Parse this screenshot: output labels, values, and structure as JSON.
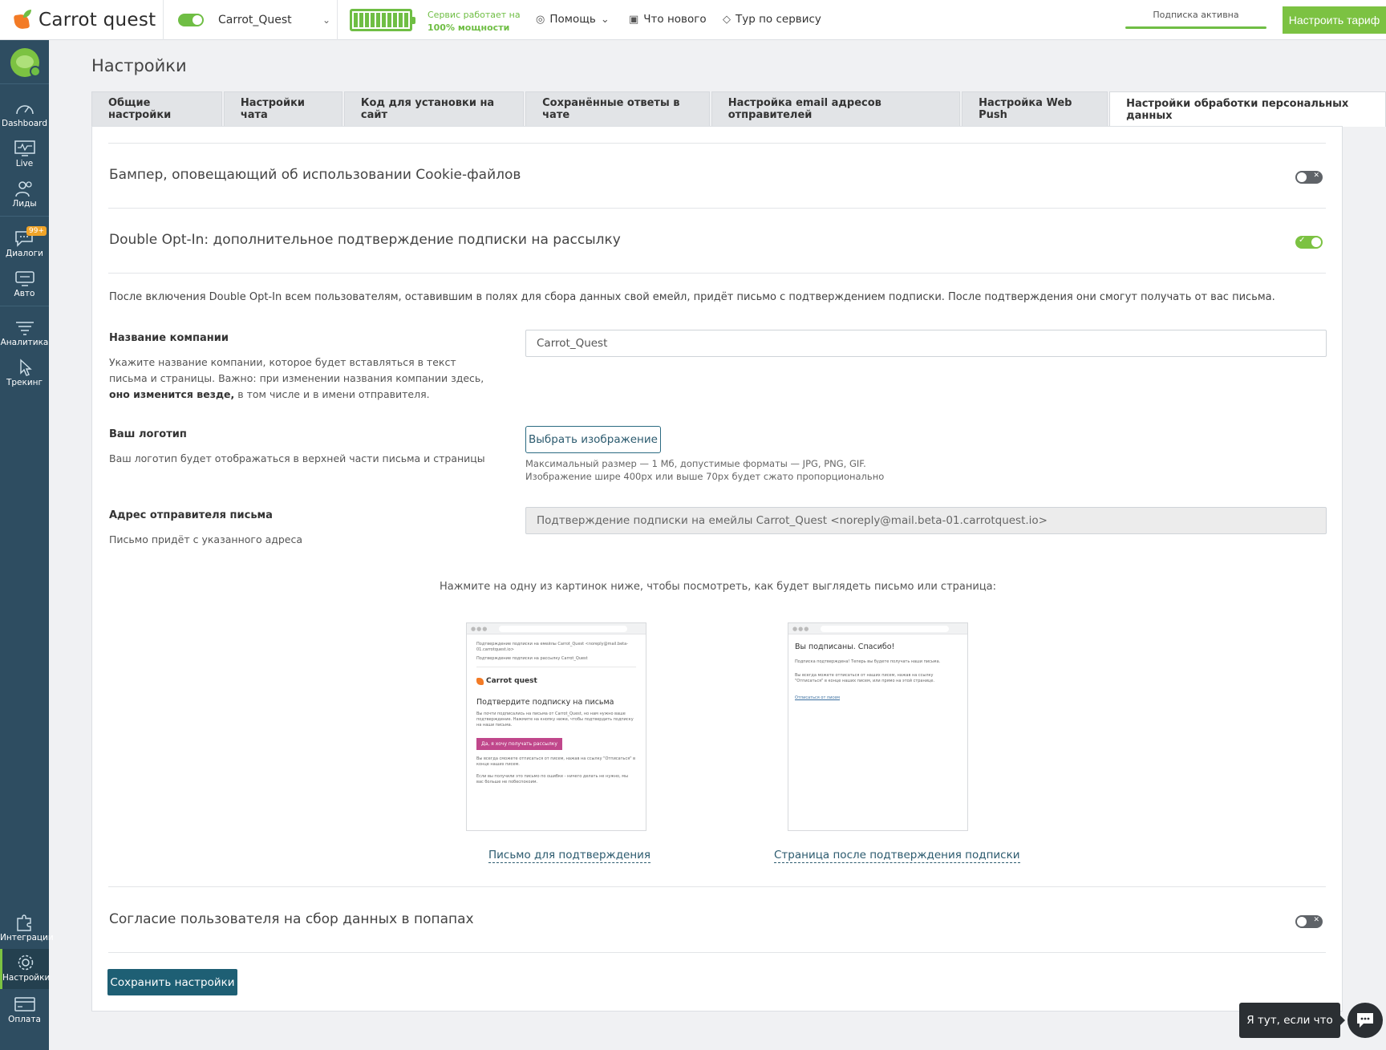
{
  "topbar": {
    "logo_text": "Carrot quest",
    "project_name": "Carrot_Quest",
    "service_status_line1": "Сервис работает на",
    "service_status_line2": "100% мощности",
    "help_label": "Помощь",
    "whats_new_label": "Что нового",
    "tour_label": "Тур по сервису",
    "subscription_label": "Подписка активна",
    "tariff_button": "Настроить тариф"
  },
  "sidebar": {
    "items": [
      {
        "label": "Dashboard"
      },
      {
        "label": "Live"
      },
      {
        "label": "Лиды"
      },
      {
        "label": "Диалоги",
        "badge": "99+"
      },
      {
        "label": "Авто"
      },
      {
        "label": "Аналитика"
      },
      {
        "label": "Трекинг"
      },
      {
        "label": "Интеграции"
      },
      {
        "label": "Настройки"
      },
      {
        "label": "Оплата"
      }
    ]
  },
  "page": {
    "title": "Настройки",
    "tabs": [
      {
        "label": "Общие настройки"
      },
      {
        "label": "Настройки чата"
      },
      {
        "label": "Код для установки на сайт"
      },
      {
        "label": "Сохранённые ответы в чате"
      },
      {
        "label": "Настройка email адресов отправителей"
      },
      {
        "label": "Настройка Web Push"
      },
      {
        "label": "Настройки обработки персональных данных"
      }
    ]
  },
  "sections": {
    "cookie": {
      "title": "Бампер, оповещающий об использовании Cookie-файлов",
      "enabled": false
    },
    "double_opt_in": {
      "title": "Double Opt-In: дополнительное подтверждение подписки на рассылку",
      "enabled": true,
      "description": "После включения Double Opt-In всем пользователям, оставившим в полях для сбора данных свой емейл, придёт письмо с подтверждением подписки. После подтверждения они смогут получать от вас письма.",
      "company_label": "Название компании",
      "company_help_1": "Укажите название компании, которое будет вставляться в текст письма и страницы. Важно: при изменении названия компании здесь,",
      "company_help_bold": "оно изменится везде,",
      "company_help_2": "в том числе и в имени отправителя.",
      "company_value": "Carrot_Quest",
      "logo_label": "Ваш логотип",
      "logo_help": "Ваш логотип будет отображаться в верхней части письма и страницы",
      "logo_button": "Выбрать изображение",
      "logo_hint_1": "Максимальный размер — 1 Мб, допустимые форматы — JPG, PNG, GIF.",
      "logo_hint_2": "Изображение шире 400px или выше 70px будет сжато пропорционально",
      "sender_label": "Адрес отправителя письма",
      "sender_help": "Письмо придёт с указанного адреса",
      "sender_value": "Подтверждение подписки на емейлы Carrot_Quest <noreply@mail.beta-01.carrotquest.io>",
      "preview_caption": "Нажмите на одну из картинок ниже, чтобы посмотреть, как будет выглядеть письмо или страница:",
      "preview_email": {
        "meta_1": "Подтверждение подписки на емейлы Carrot_Quest <noreply@mail.beta-01.carrotquest.io>",
        "meta_2": "Подтверждение подписки на рассылку Carrot_Quest",
        "brand": "Carrot quest",
        "heading": "Подтвердите подписку на письма",
        "body": "Вы почти подписались на письма от Carrot_Quest, но нам нужно ваше подтверждение. Нажмите на кнопку ниже, чтобы подтвердить подписку на наши письма.",
        "button": "Да, я хочу получать рассылку",
        "body_2": "Вы всегда сможете отписаться от писем, нажав на ссылку \"Отписаться\" в конце наших писем.",
        "body_3": "Если вы получили это письмо по ошибке - ничего делать не нужно, мы вас больше не побеспокоим."
      },
      "preview_page": {
        "heading": "Вы подписаны. Спасибо!",
        "body": "Подписка подтверждена! Теперь вы будете получать наши письма.",
        "body_2": "Вы всегда можете отписаться от наших писем, нажав на ссылку \"Отписаться\" в конце наших писем, или прямо на этой странице.",
        "link": "Отписаться от писем"
      },
      "link_email": "Письмо для подтверждения",
      "link_page": "Страница после подтверждения подписки"
    },
    "popup_consent": {
      "title": "Согласие пользователя на сбор данных в попапах",
      "enabled": false
    }
  },
  "save_button": "Сохранить настройки",
  "chat": {
    "tooltip": "Я тут, если что"
  },
  "colors": {
    "brand_green": "#7cc242",
    "sidebar": "#2e4d61",
    "primary": "#1e5f74",
    "accent_orange": "#f37b26"
  }
}
